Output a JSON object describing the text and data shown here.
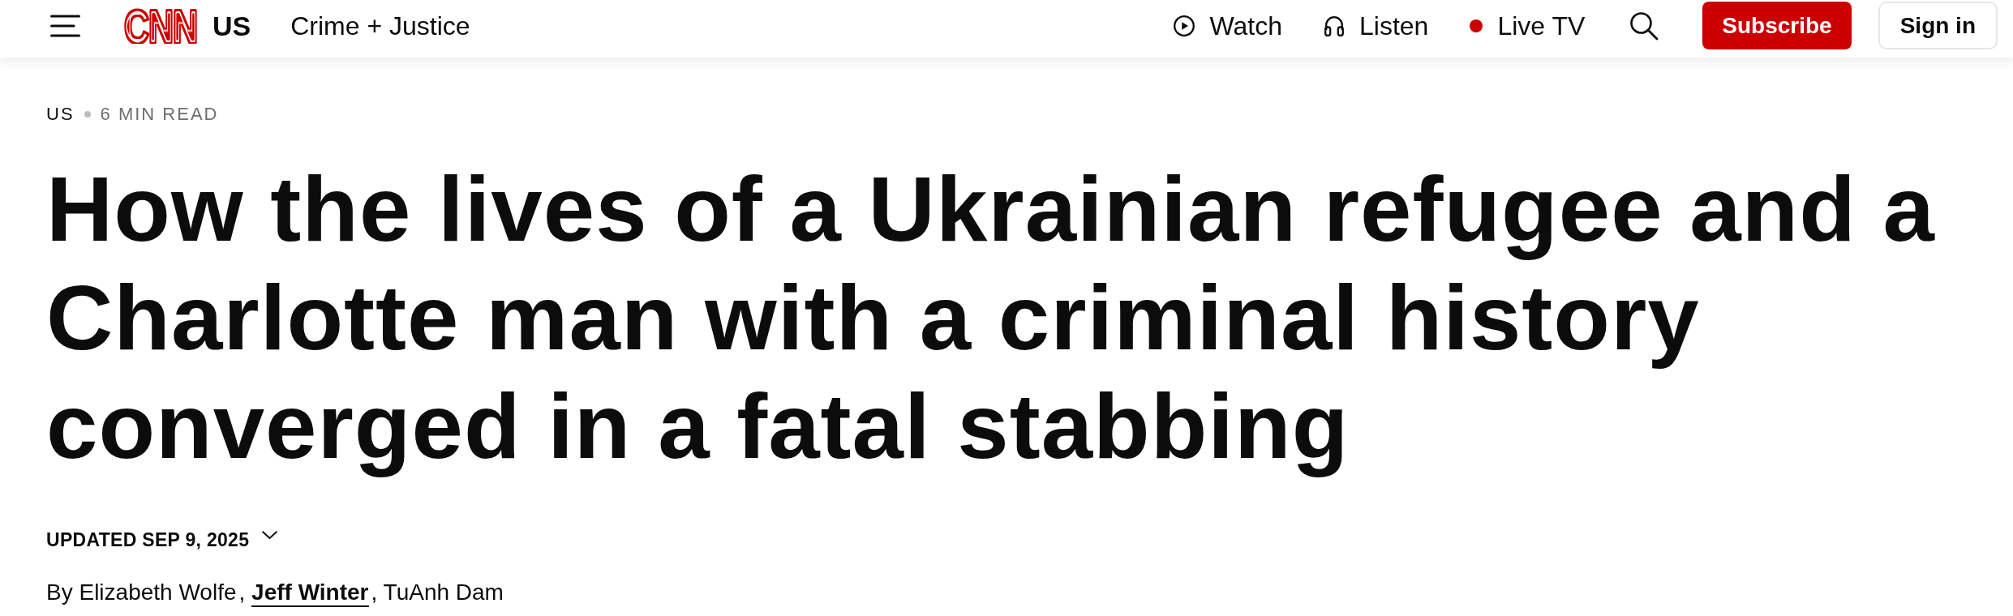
{
  "header": {
    "logo": "CNN",
    "edition": "US",
    "section_link": "Crime + Justice",
    "nav": [
      {
        "kind": "watch",
        "label": "Watch"
      },
      {
        "kind": "listen",
        "label": "Listen"
      },
      {
        "kind": "live",
        "label": "Live TV"
      }
    ],
    "subscribe_button": "Subscribe",
    "sign_in_button": "Sign in"
  },
  "article": {
    "section": "US",
    "read_time": "6 MIN READ",
    "headline": "How the lives of a Ukrainian refugee and a Charlotte man with a criminal history converged in a fatal stabbing",
    "timestamp": {
      "text": "UPDATED SEP 9, 2025",
      "expanded": false
    },
    "byline": {
      "prefix": "By",
      "authors": [
        {
          "name": "Elizabeth Wolfe",
          "linked": false,
          "separator": ","
        },
        {
          "name": "Jeff Winter",
          "linked": true,
          "separator": ","
        },
        {
          "name": "TuAnh Dam",
          "linked": false
        }
      ]
    }
  }
}
